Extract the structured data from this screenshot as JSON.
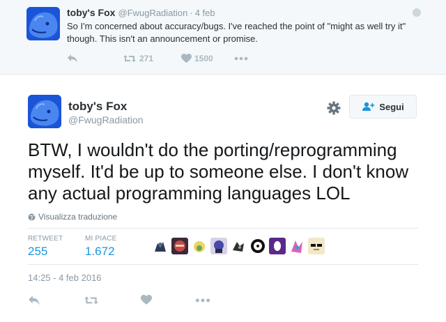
{
  "parent_tweet": {
    "name": "toby's Fox",
    "handle": "@FwugRadiation",
    "separator": "·",
    "date": "4 feb",
    "text": "So I'm concerned about accuracy/bugs. I've reached the point of \"might as well try it\" though. This isn't an announcement or promise.",
    "retweet_count": "271",
    "like_count": "1500"
  },
  "main_tweet": {
    "name": "toby's Fox",
    "handle": "@FwugRadiation",
    "follow_label": "Segui",
    "text": "BTW, I wouldn't do the porting/reprogramming myself. It'd be up to someone else. I don't know any actual programming languages LOL",
    "translate_label": "Visualizza traduzione",
    "stats": {
      "retweet_label": "RETWEET",
      "retweet_value": "255",
      "likes_label": "MI PIACE",
      "likes_value": "1.672"
    },
    "timestamp": "14:25 - 4 feb 2016"
  },
  "colors": {
    "accent": "#1b95e0",
    "muted": "#8899a6",
    "icon": "#aab8c2",
    "avatar_bg": "#1a55d8"
  },
  "icons": [
    "reply-icon",
    "retweet-icon",
    "heart-icon",
    "more-icon",
    "gear-icon",
    "follow-user-icon",
    "globe-icon"
  ]
}
